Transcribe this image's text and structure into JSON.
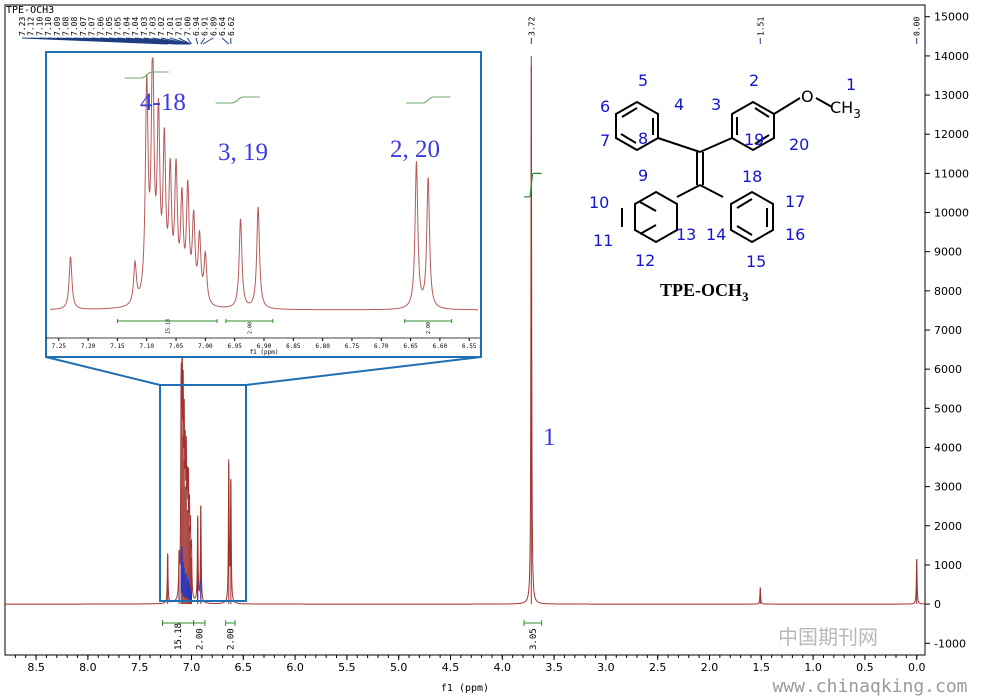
{
  "chart_data": {
    "type": "line",
    "title": "TPE-OCH3",
    "xlabel": "f1 (ppm)",
    "ylabel": "",
    "x_reversed": true,
    "xlim": [
      8.8,
      -0.08
    ],
    "ylim": [
      -1300,
      15300
    ],
    "x_ticks": [
      "8.5",
      "8.0",
      "7.5",
      "7.0",
      "6.5",
      "6.0",
      "5.5",
      "5.0",
      "4.5",
      "4.0",
      "3.5",
      "3.0",
      "2.5",
      "2.0",
      "1.5",
      "1.0",
      "0.5",
      "0.0"
    ],
    "y_ticks": [
      "-1000",
      "0",
      "1000",
      "2000",
      "3000",
      "4000",
      "5000",
      "6000",
      "7000",
      "8000",
      "9000",
      "10000",
      "11000",
      "12000",
      "13000",
      "14000",
      "15000"
    ],
    "peak_labels": [
      "7.23",
      "7.12",
      "7.10",
      "7.10",
      "7.09",
      "7.08",
      "7.08",
      "7.07",
      "7.07",
      "7.06",
      "7.05",
      "7.05",
      "7.04",
      "7.04",
      "7.03",
      "7.03",
      "7.02",
      "7.01",
      "7.01",
      "7.00",
      "6.94",
      "6.91",
      "6.89",
      "6.64",
      "6.62",
      "3.72",
      "1.51",
      "0.00"
    ],
    "peaks": [
      {
        "x": 7.23,
        "y": 1300
      },
      {
        "x": 7.12,
        "y": 1000
      },
      {
        "x": 7.1,
        "y": 5200
      },
      {
        "x": 7.09,
        "y": 5900
      },
      {
        "x": 7.08,
        "y": 4300
      },
      {
        "x": 7.07,
        "y": 3700
      },
      {
        "x": 7.06,
        "y": 3000
      },
      {
        "x": 7.05,
        "y": 3100
      },
      {
        "x": 7.04,
        "y": 2400
      },
      {
        "x": 7.03,
        "y": 2700
      },
      {
        "x": 7.02,
        "y": 2000
      },
      {
        "x": 7.01,
        "y": 1600
      },
      {
        "x": 7.0,
        "y": 1200
      },
      {
        "x": 6.94,
        "y": 2200
      },
      {
        "x": 6.91,
        "y": 2500
      },
      {
        "x": 6.64,
        "y": 3600
      },
      {
        "x": 6.62,
        "y": 3200
      },
      {
        "x": 3.72,
        "y": 14000
      },
      {
        "x": 1.51,
        "y": 420
      },
      {
        "x": 0.0,
        "y": 1150
      }
    ],
    "integrals": [
      {
        "x_from": 7.28,
        "x_to": 6.98,
        "value": "15.18"
      },
      {
        "x_from": 6.98,
        "x_to": 6.87,
        "value": "2.00"
      },
      {
        "x_from": 6.67,
        "x_to": 6.58,
        "value": "2.00"
      },
      {
        "x_from": 3.79,
        "x_to": 3.62,
        "value": "3.05"
      }
    ],
    "annotations": [
      "1"
    ]
  },
  "inset": {
    "x_ticks": [
      "7.25",
      "7.20",
      "7.15",
      "7.10",
      "7.05",
      "7.00",
      "6.95",
      "6.90",
      "6.85",
      "6.80",
      "6.75",
      "6.70",
      "6.65",
      "6.60",
      "6.55"
    ],
    "xlabel": "f1 (ppm)",
    "xlim": [
      7.265,
      6.535
    ],
    "labels": [
      "4-18",
      "3, 19",
      "2, 20"
    ],
    "integrals": [
      "15.18",
      "2.00",
      "2.00"
    ]
  },
  "molecule": {
    "caption_main": "TPE-OCH",
    "caption_sub": "3",
    "atom_numbers": [
      "1",
      "2",
      "3",
      "4",
      "5",
      "6",
      "7",
      "8",
      "9",
      "10",
      "11",
      "12",
      "13",
      "14",
      "15",
      "16",
      "17",
      "18",
      "19",
      "20"
    ],
    "oxygen": "O",
    "methyl": "CH",
    "methyl_sub": "3"
  },
  "watermark": {
    "cn": "中国期刊网",
    "url": "www.chinaqking.com"
  },
  "colors": {
    "spectrum": "#a0332f",
    "integral": "#2e8b2e",
    "zoom_box": "#1e6fb3",
    "label_blue": "#3a3ae0",
    "axis": "#000000"
  }
}
